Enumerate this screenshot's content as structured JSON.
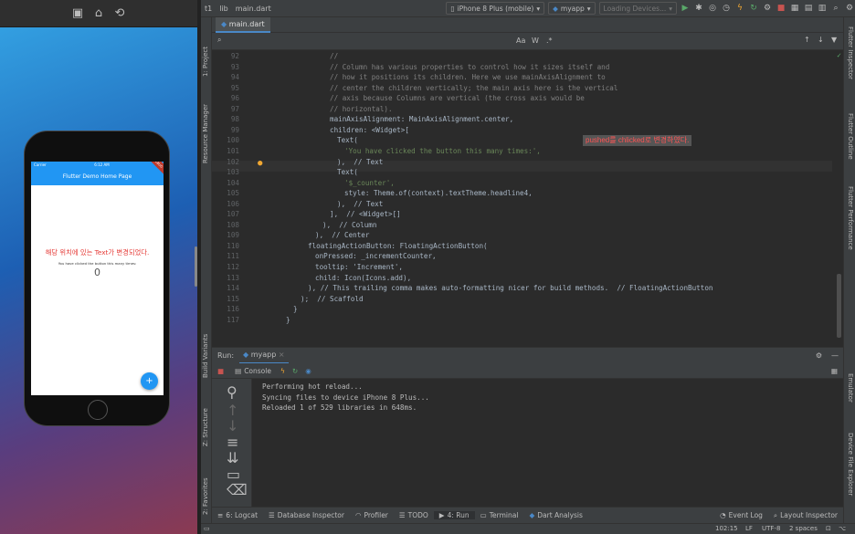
{
  "simulator": {
    "app_title": "Flutter Demo Home Page",
    "carrier": "Carrier",
    "time": "6:12 AM",
    "debug_badge": "DEBUG",
    "korean_text": "해당 위치에 있는 Text가 변경되었다.",
    "message": "You have clicked the button this many times:",
    "counter": "0",
    "fab_label": "+"
  },
  "ide": {
    "breadcrumb": [
      "t1",
      "lib",
      "main.dart"
    ],
    "device": "iPhone 8 Plus (mobile)",
    "config": "myapp",
    "loading": "Loading Devices...",
    "tab": "main.dart",
    "find_aa": "Aa",
    "find_w": "W",
    "find_re": ".*",
    "left_tabs": [
      "1: Project",
      "Resource Manager",
      "Build Variants",
      "Z: Structure",
      "2: Favorites"
    ],
    "right_tabs": [
      "Flutter Inspector",
      "Flutter Outline",
      "Flutter Performance",
      "Emulator",
      "Device File Explorer"
    ],
    "popup": "pushed를 chlicked로 변경하였다.",
    "code_lines": [
      {
        "n": "92",
        "t": "//"
      },
      {
        "n": "93",
        "t": "// Column has various properties to control how it sizes itself and"
      },
      {
        "n": "94",
        "t": "// how it positions its children. Here we use mainAxisAlignment to"
      },
      {
        "n": "95",
        "t": "// center the children vertically; the main axis here is the vertical"
      },
      {
        "n": "96",
        "t": "// axis because Columns are vertical (the cross axis would be"
      },
      {
        "n": "97",
        "t": "// horizontal)."
      },
      {
        "n": "98",
        "t": "mainAxisAlignment: MainAxisAlignment.center,"
      },
      {
        "n": "99",
        "t": "children: <Widget>["
      },
      {
        "n": "100",
        "t": "Text("
      },
      {
        "n": "101",
        "t": "'You have clicked the button this many times:',"
      },
      {
        "n": "102",
        "t": "),  // Text"
      },
      {
        "n": "103",
        "t": "Text("
      },
      {
        "n": "104",
        "t": "'$_counter',"
      },
      {
        "n": "105",
        "t": "style: Theme.of(context).textTheme.headline4,"
      },
      {
        "n": "106",
        "t": "),  // Text"
      },
      {
        "n": "107",
        "t": "],  // <Widget>[]"
      },
      {
        "n": "108",
        "t": "),  // Column"
      },
      {
        "n": "109",
        "t": "),  // Center"
      },
      {
        "n": "110",
        "t": "floatingActionButton: FloatingActionButton("
      },
      {
        "n": "111",
        "t": "onPressed: _incrementCounter,"
      },
      {
        "n": "112",
        "t": "tooltip: 'Increment',"
      },
      {
        "n": "113",
        "t": "child: Icon(Icons.add),"
      },
      {
        "n": "114",
        "t": "), // This trailing comma makes auto-formatting nicer for build methods.  // FloatingActionButton"
      },
      {
        "n": "115",
        "t": ");  // Scaffold"
      },
      {
        "n": "116",
        "t": "}"
      },
      {
        "n": "117",
        "t": "}"
      }
    ],
    "run_label": "Run:",
    "run_config": "myapp",
    "console_tab": "Console",
    "console_lines": [
      "Performing hot reload...",
      "Syncing files to device iPhone 8 Plus...",
      "Reloaded 1 of 529 libraries in 648ms."
    ],
    "bottom_tabs": [
      "6: Logcat",
      "Database Inspector",
      "Profiler",
      "TODO",
      "4: Run",
      "Terminal",
      "Dart Analysis"
    ],
    "bottom_right": [
      "Event Log",
      "Layout Inspector"
    ],
    "status": {
      "pos": "102:15",
      "le": "LF",
      "enc": "UTF-8",
      "indent": "2 spaces"
    },
    "colors": {
      "accent": "#4a88c7",
      "flutter_blue": "#2196f3",
      "error_red": "#e53935"
    }
  }
}
